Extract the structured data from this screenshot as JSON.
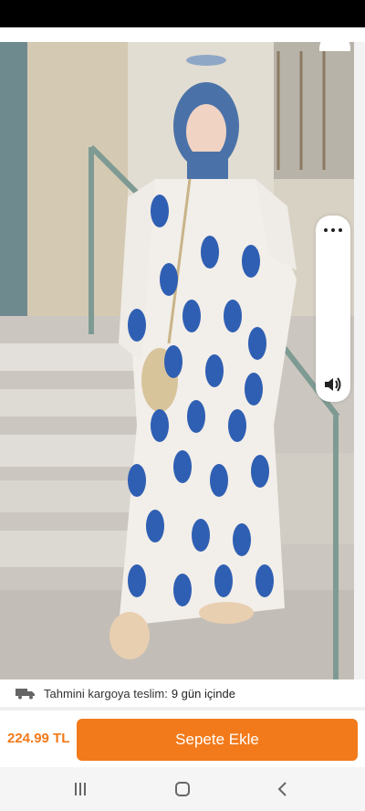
{
  "shipping": {
    "label": "Tahmini kargoya teslim:",
    "days": "9 gün içinde"
  },
  "cart": {
    "price": "224.99 TL",
    "button_label": "Sepete Ekle"
  },
  "icons": {
    "shipping": "truck-icon",
    "more": "more-icon",
    "sound": "sound-icon",
    "nav_recent": "recent-apps-icon",
    "nav_home": "home-icon",
    "nav_back": "back-icon"
  },
  "colors": {
    "accent": "#f27a1a",
    "dress_pattern": "#2f5fb3"
  }
}
